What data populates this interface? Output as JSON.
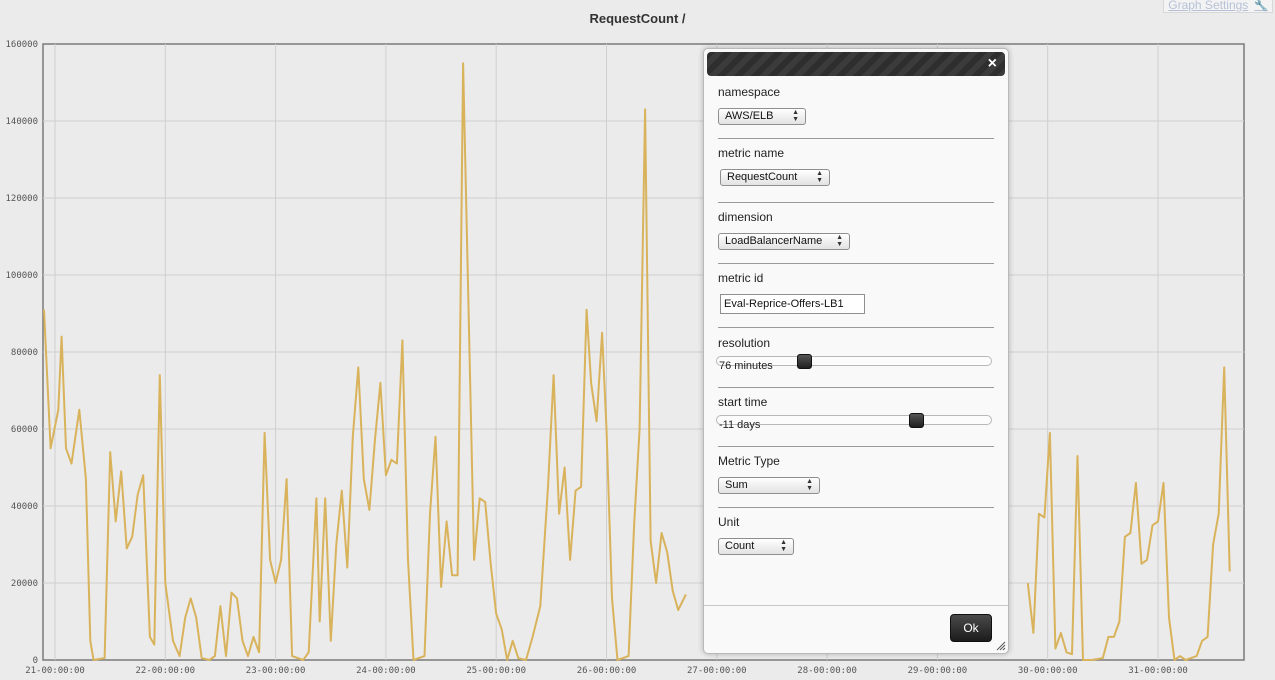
{
  "page": {
    "title": "RequestCount /"
  },
  "header": {
    "graph_settings_label": "Graph Settings",
    "wrench_icon": "wrench-icon"
  },
  "colors": {
    "series": "#d9b35c",
    "dialog_header": "#2f2f2f",
    "grid": "#cfcfcf"
  },
  "chart_data": {
    "type": "line",
    "title": "",
    "xlabel": "",
    "ylabel": "",
    "ylim": [
      0,
      160000
    ],
    "grid": true,
    "yticks": [
      0,
      20000,
      40000,
      60000,
      80000,
      100000,
      120000,
      140000,
      160000
    ],
    "ytick_labels": [
      "0",
      "20000",
      "40000",
      "60000",
      "80000",
      "100000",
      "120000",
      "140000",
      "160000"
    ],
    "xlim_days": [
      20.9,
      32.9
    ],
    "xticks": [
      21,
      22,
      23,
      24,
      25,
      26,
      27,
      28,
      29,
      30,
      31
    ],
    "xtick_labels": [
      "21-00:00:00",
      "22-00:00:00",
      "23-00:00:00",
      "24-00:00:00",
      "25-00:00:00",
      "26-00:00:00",
      "27-00:00:00",
      "28-00:00:00",
      "29-00:00:00",
      "30-00:00:00",
      "31-00:00:00"
    ],
    "series": [
      {
        "points": [
          [
            20.9,
            91000
          ],
          [
            20.96,
            55000
          ],
          [
            21.03,
            65000
          ],
          [
            21.06,
            84000
          ],
          [
            21.1,
            55000
          ],
          [
            21.15,
            51000
          ],
          [
            21.22,
            65000
          ],
          [
            21.28,
            47000
          ],
          [
            21.32,
            5000
          ],
          [
            21.35,
            0
          ],
          [
            21.45,
            500
          ],
          [
            21.5,
            54000
          ],
          [
            21.55,
            36000
          ],
          [
            21.6,
            49000
          ],
          [
            21.65,
            29000
          ],
          [
            21.7,
            32000
          ],
          [
            21.75,
            43000
          ],
          [
            21.8,
            48000
          ],
          [
            21.86,
            6000
          ],
          [
            21.9,
            4000
          ],
          [
            21.95,
            74000
          ],
          [
            22.0,
            20000
          ],
          [
            22.07,
            5000
          ],
          [
            22.13,
            1000
          ],
          [
            22.18,
            11000
          ],
          [
            22.23,
            16000
          ],
          [
            22.28,
            11000
          ],
          [
            22.33,
            500
          ],
          [
            22.4,
            0
          ],
          [
            22.45,
            1000
          ],
          [
            22.5,
            14000
          ],
          [
            22.55,
            1000
          ],
          [
            22.6,
            17500
          ],
          [
            22.65,
            16000
          ],
          [
            22.7,
            5000
          ],
          [
            22.75,
            1000
          ],
          [
            22.8,
            6000
          ],
          [
            22.85,
            2000
          ],
          [
            22.9,
            59000
          ],
          [
            22.95,
            26000
          ],
          [
            23.0,
            20000
          ],
          [
            23.05,
            26000
          ],
          [
            23.1,
            47000
          ],
          [
            23.15,
            1000
          ],
          [
            23.25,
            0
          ],
          [
            23.3,
            2000
          ],
          [
            23.37,
            42000
          ],
          [
            23.4,
            10000
          ],
          [
            23.45,
            42000
          ],
          [
            23.5,
            5000
          ],
          [
            23.55,
            30000
          ],
          [
            23.6,
            44000
          ],
          [
            23.65,
            24000
          ],
          [
            23.7,
            58000
          ],
          [
            23.75,
            76000
          ],
          [
            23.8,
            47000
          ],
          [
            23.85,
            39000
          ],
          [
            23.9,
            57000
          ],
          [
            23.95,
            72000
          ],
          [
            24.0,
            48000
          ],
          [
            24.05,
            52000
          ],
          [
            24.1,
            51000
          ],
          [
            24.15,
            83000
          ],
          [
            24.2,
            26000
          ],
          [
            24.25,
            0
          ],
          [
            24.35,
            1000
          ],
          [
            24.4,
            38000
          ],
          [
            24.45,
            58000
          ],
          [
            24.5,
            19000
          ],
          [
            24.55,
            36000
          ],
          [
            24.6,
            22000
          ],
          [
            24.65,
            22000
          ],
          [
            24.7,
            155000
          ],
          [
            24.8,
            26000
          ],
          [
            24.85,
            42000
          ],
          [
            24.9,
            41000
          ],
          [
            24.95,
            25000
          ],
          [
            25.0,
            12000
          ],
          [
            25.05,
            8000
          ],
          [
            25.1,
            0
          ],
          [
            25.15,
            5000
          ],
          [
            25.2,
            500
          ],
          [
            25.27,
            0
          ],
          [
            25.33,
            6000
          ],
          [
            25.4,
            14000
          ],
          [
            25.47,
            45000
          ],
          [
            25.52,
            74000
          ],
          [
            25.57,
            38000
          ],
          [
            25.62,
            50000
          ],
          [
            25.67,
            26000
          ],
          [
            25.72,
            44000
          ],
          [
            25.77,
            45000
          ],
          [
            25.82,
            91000
          ],
          [
            25.86,
            72000
          ],
          [
            25.91,
            62000
          ],
          [
            25.96,
            85000
          ],
          [
            26.0,
            60000
          ],
          [
            26.05,
            16000
          ],
          [
            26.1,
            0
          ],
          [
            26.2,
            1000
          ],
          [
            26.25,
            35000
          ],
          [
            26.3,
            60000
          ],
          [
            26.35,
            143000
          ],
          [
            26.4,
            31000
          ],
          [
            26.45,
            20000
          ],
          [
            26.5,
            33000
          ],
          [
            26.55,
            28000
          ],
          [
            26.6,
            18000
          ],
          [
            26.65,
            13000
          ],
          [
            26.72,
            17000
          ],
          [
            29.82,
            20000
          ],
          [
            29.87,
            7000
          ],
          [
            29.92,
            38000
          ],
          [
            29.97,
            37000
          ],
          [
            30.02,
            59000
          ],
          [
            30.07,
            3000
          ],
          [
            30.12,
            7000
          ],
          [
            30.17,
            2000
          ],
          [
            30.22,
            1500
          ],
          [
            30.27,
            53000
          ],
          [
            30.32,
            0
          ],
          [
            30.4,
            0
          ],
          [
            30.5,
            500
          ],
          [
            30.55,
            6000
          ],
          [
            30.6,
            6000
          ],
          [
            30.65,
            10000
          ],
          [
            30.7,
            32000
          ],
          [
            30.75,
            33000
          ],
          [
            30.8,
            46000
          ],
          [
            30.85,
            25000
          ],
          [
            30.9,
            26000
          ],
          [
            30.95,
            35000
          ],
          [
            31.0,
            36000
          ],
          [
            31.05,
            46000
          ],
          [
            31.1,
            11000
          ],
          [
            31.15,
            0
          ],
          [
            31.2,
            1000
          ],
          [
            31.25,
            0
          ],
          [
            31.35,
            1000
          ],
          [
            31.4,
            5000
          ],
          [
            31.45,
            6000
          ],
          [
            31.5,
            30000
          ],
          [
            31.55,
            38000
          ],
          [
            31.6,
            76000
          ],
          [
            31.65,
            23000
          ]
        ]
      }
    ]
  },
  "dialog": {
    "close_label": "×",
    "namespace": {
      "label": "namespace",
      "value": "AWS/ELB"
    },
    "metric_name": {
      "label": "metric name",
      "value": "RequestCount"
    },
    "dimension": {
      "label": "dimension",
      "value": "LoadBalancerName"
    },
    "metric_id": {
      "label": "metric id",
      "value": "Eval-Reprice-Offers-LB1"
    },
    "resolution": {
      "label": "resolution",
      "value_text": "76 minutes",
      "position_fraction": 0.31
    },
    "start_time": {
      "label": "start time",
      "value_text": "-11 days",
      "position_fraction": 0.74
    },
    "metric_type": {
      "label": "Metric Type",
      "value": "Sum"
    },
    "unit": {
      "label": "Unit",
      "value": "Count"
    },
    "ok_label": "Ok"
  }
}
